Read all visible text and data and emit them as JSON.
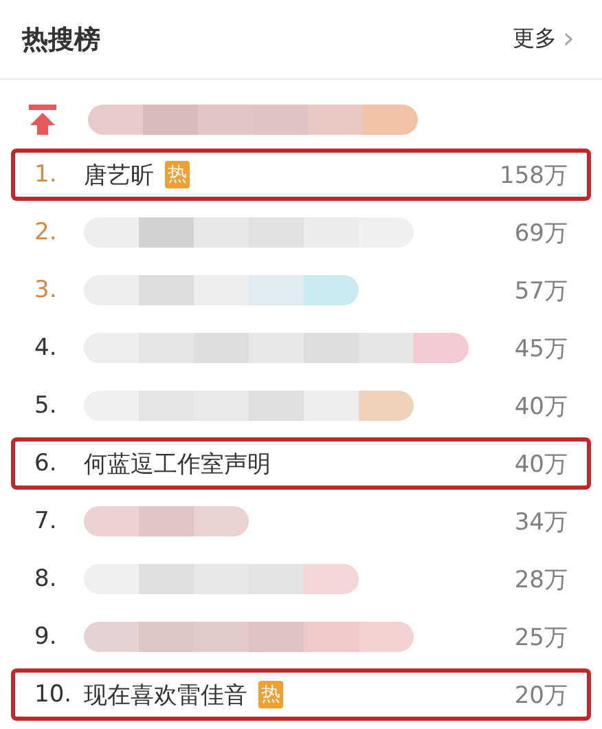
{
  "header": {
    "title": "热搜榜",
    "more": "更多",
    "chevron": "›"
  },
  "pinned": {
    "blurred": true
  },
  "rows": [
    {
      "rank": "1.",
      "kind": "top",
      "title": "唐艺昕",
      "badge": "热",
      "count": "158万",
      "highlighted": true,
      "blurred": false
    },
    {
      "rank": "2.",
      "kind": "top",
      "count": "69万",
      "highlighted": false,
      "blurred": true
    },
    {
      "rank": "3.",
      "kind": "top",
      "count": "57万",
      "highlighted": false,
      "blurred": true
    },
    {
      "rank": "4.",
      "kind": "normal",
      "count": "45万",
      "highlighted": false,
      "blurred": true
    },
    {
      "rank": "5.",
      "kind": "normal",
      "count": "40万",
      "highlighted": false,
      "blurred": true
    },
    {
      "rank": "6.",
      "kind": "normal",
      "title": "何蓝逗工作室声明",
      "count": "40万",
      "highlighted": true,
      "blurred": false
    },
    {
      "rank": "7.",
      "kind": "normal",
      "count": "34万",
      "highlighted": false,
      "blurred": true
    },
    {
      "rank": "8.",
      "kind": "normal",
      "count": "28万",
      "highlighted": false,
      "blurred": true
    },
    {
      "rank": "9.",
      "kind": "normal",
      "count": "25万",
      "highlighted": false,
      "blurred": true
    },
    {
      "rank": "10.",
      "kind": "normal",
      "title": "现在喜欢雷佳音",
      "badge": "热",
      "count": "20万",
      "highlighted": true,
      "blurred": false
    }
  ]
}
